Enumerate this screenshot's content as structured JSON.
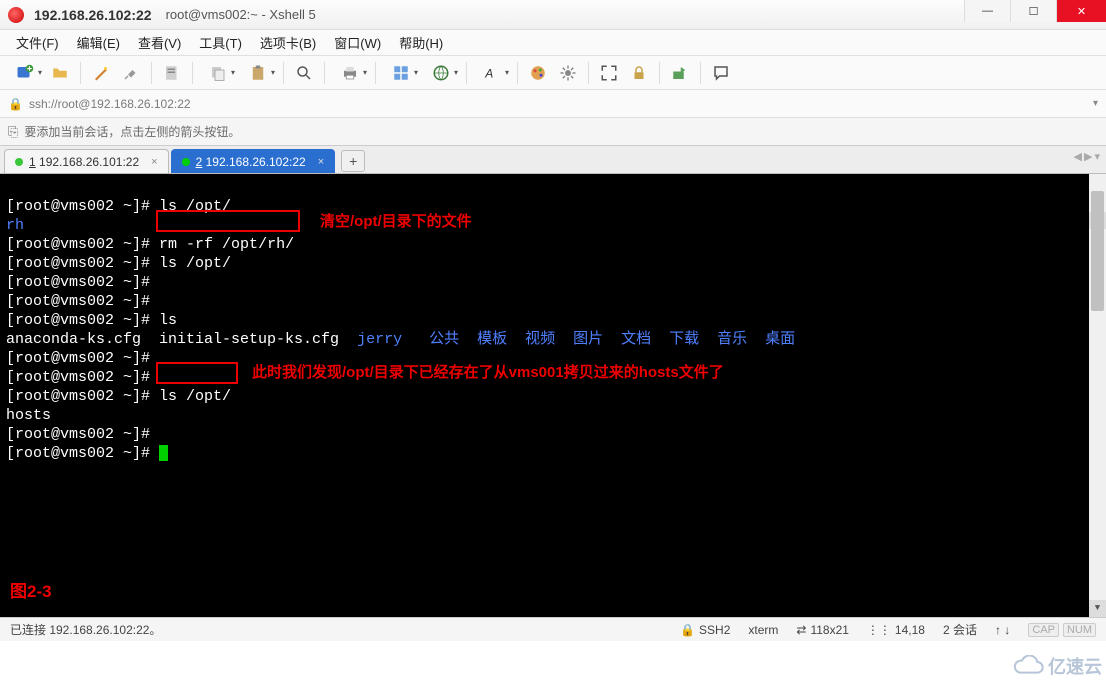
{
  "title": {
    "ip": "192.168.26.102:22",
    "extra": "root@vms002:~ - Xshell 5"
  },
  "menus": {
    "file": "文件(F)",
    "edit": "编辑(E)",
    "view": "查看(V)",
    "tools": "工具(T)",
    "tabs": "选项卡(B)",
    "window": "窗口(W)",
    "help": "帮助(H)"
  },
  "address": "ssh://root@192.168.26.102:22",
  "hint": "要添加当前会话，点击左侧的箭头按钮。",
  "tabs": {
    "t1": {
      "num": "1",
      "label": "192.168.26.101:22",
      "dotcolor": "#39c639"
    },
    "t2": {
      "num": "2",
      "label": "192.168.26.102:22",
      "dotcolor": "#00d000"
    },
    "add": "+"
  },
  "tabnav": {
    "left": "◀",
    "right": "▶",
    "drop": "▾"
  },
  "term": {
    "prompt": "[root@vms002 ~]#",
    "cmd_ls_opt": "ls /opt/",
    "out_rh": "rh",
    "cmd_rm": "rm -rf /opt/rh/",
    "cmd_ls": "ls",
    "ana": "anaconda-ks.cfg  initial-setup-ks.cfg  ",
    "jerry": "jerry",
    "dirs": "   公共  模板  视频  图片  文档  下载  音乐  桌面",
    "out_hosts": "hosts"
  },
  "annotations": {
    "a1": "清空/opt/目录下的文件",
    "a2": "此时我们发现/opt/目录下已经存在了从vms001拷贝过来的hosts文件了",
    "fig": "图2-3"
  },
  "status": {
    "conn": "已连接 192.168.26.102:22。",
    "proto": "SSH2",
    "termtype": "xterm",
    "size": "118x21",
    "pos": "14,18",
    "sess": "2 会话",
    "up": "↕",
    "left": "⇄",
    "cap": "CAP",
    "num": "NUM"
  },
  "watermark": "亿速云"
}
